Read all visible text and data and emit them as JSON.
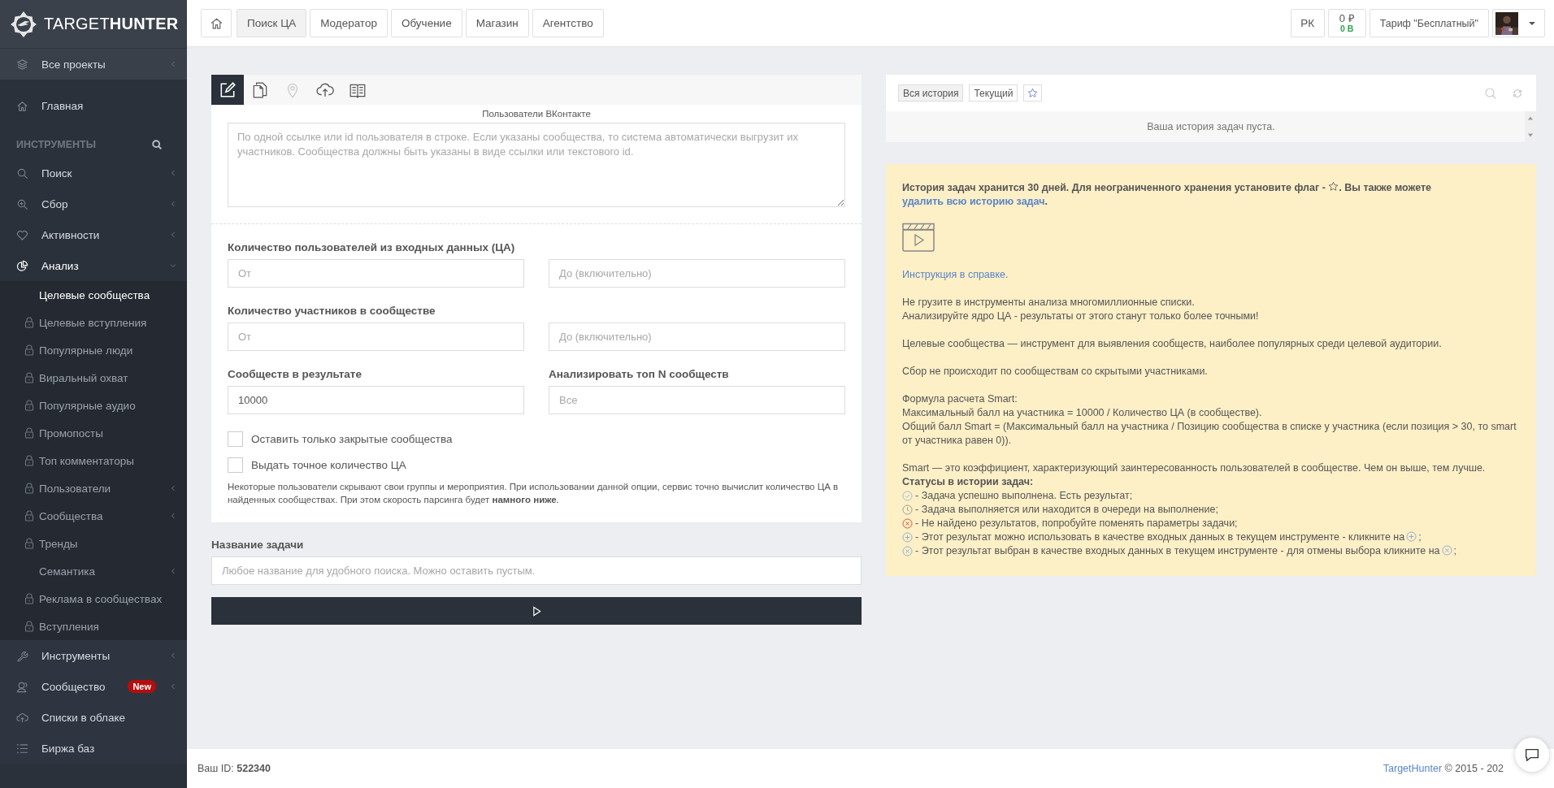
{
  "sidebar": {
    "logo": {
      "light": "TARGET",
      "bold": "HUNTER"
    },
    "items": [
      {
        "kind": "band",
        "label": "Все проекты",
        "has_submenu": true
      },
      {
        "kind": "link",
        "label": "Главная"
      },
      {
        "kind": "header",
        "label": "ИНСТРУМЕНТЫ"
      },
      {
        "kind": "link",
        "label": "Поиск",
        "has_submenu": true
      },
      {
        "kind": "link",
        "label": "Сбор",
        "has_submenu": true
      },
      {
        "kind": "link",
        "label": "Активности",
        "has_submenu": true
      },
      {
        "kind": "link",
        "label": "Анализ",
        "has_submenu": true,
        "expanded": true,
        "children": [
          {
            "label": "Целевые сообщества",
            "locked": false,
            "selected": true
          },
          {
            "label": "Целевые вступления",
            "locked": true,
            "selected": false
          },
          {
            "label": "Популярные люди",
            "locked": true,
            "selected": false
          },
          {
            "label": "Виральный охват",
            "locked": true,
            "selected": false
          },
          {
            "label": "Популярные аудио",
            "locked": true,
            "selected": false
          },
          {
            "label": "Промопосты",
            "locked": true,
            "selected": false
          },
          {
            "label": "Топ комментаторы",
            "locked": true,
            "selected": false
          },
          {
            "label": "Пользователи",
            "locked": true,
            "selected": false,
            "has_submenu": true
          },
          {
            "label": "Сообщества",
            "locked": true,
            "selected": false,
            "has_submenu": true
          },
          {
            "label": "Тренды",
            "locked": true,
            "selected": false
          },
          {
            "label": "Семантика",
            "locked": false,
            "selected": false,
            "has_submenu": true
          },
          {
            "label": "Реклама в сообществах",
            "locked": true,
            "selected": false
          },
          {
            "label": "Вступления",
            "locked": true,
            "selected": false
          }
        ]
      },
      {
        "kind": "lower",
        "label": "Инструменты",
        "has_submenu": true
      },
      {
        "kind": "lower",
        "label": "Сообщество",
        "badge": "New",
        "has_submenu": true
      },
      {
        "kind": "lower",
        "label": "Списки в облаке"
      },
      {
        "kind": "lower",
        "label": "Биржа баз"
      }
    ]
  },
  "topbar": {
    "tabs": [
      {
        "label": "Поиск ЦА",
        "selected": true
      },
      {
        "label": "Модератор",
        "selected": false
      },
      {
        "label": "Обучение",
        "selected": false
      },
      {
        "label": "Магазин",
        "selected": false
      },
      {
        "label": "Агентство",
        "selected": false
      }
    ],
    "rk": "РК",
    "balance": "0 ₽",
    "bonus": "0 В",
    "tariff": "Тариф \"Бесплатный\""
  },
  "form": {
    "tabs": [
      {
        "selected": true,
        "disabled": false
      },
      {
        "selected": false,
        "disabled": false
      },
      {
        "selected": false,
        "disabled": true
      },
      {
        "selected": false,
        "disabled": false
      },
      {
        "selected": false,
        "disabled": false
      }
    ],
    "source_label": "Пользователи ВКонтакте",
    "source_placeholder": "По одной ссылке или id пользователя в строке. Если указаны сообщества, то система автоматически выгрузит их участников. Сообщества должны быть указаны в виде ссылки или текстового id.",
    "rows": [
      [
        {
          "label": "Количество пользователей из входных данных (ЦА)",
          "placeholder": "От"
        },
        {
          "placeholder": "До (включительно)"
        }
      ],
      [
        {
          "label": "Количество участников в сообществе",
          "placeholder": "От"
        },
        {
          "placeholder": "До (включительно)"
        }
      ],
      [
        {
          "label": "Сообществ в результате",
          "value": "10000"
        },
        {
          "label": "Анализировать топ N сообществ",
          "placeholder": "Все"
        }
      ]
    ],
    "checkboxes": [
      {
        "label": "Оставить только закрытые сообщества",
        "checked": false
      },
      {
        "label": "Выдать точное количество ЦА",
        "checked": false
      }
    ],
    "note": "Некоторые пользователи скрывают свои группы и мероприятия. При использовании данной опции, сервис точно вычислит количество ЦА в найденных сообществах. При этом скорость парсинга будет **намного ниже**.",
    "task_label": "Название задачи",
    "task_placeholder": "Любое название для удобного поиска. Можно оставить пустым."
  },
  "history": {
    "filters": [
      {
        "label": "Вся история",
        "selected": true
      },
      {
        "label": "Текущий",
        "selected": false
      }
    ],
    "empty": "Ваша история задач пуста."
  },
  "notice": {
    "intro_before": "История задач хранится 30 дней. Для неограниченного хранения установите флаг - ",
    "intro_after": ". Вы также можете ",
    "delete_link": "удалить всю историю задач",
    "intro_end": ".",
    "help_link": "Инструкция в справке.",
    "paragraphs": [
      [
        "Не грузите в инструменты анализа многомиллионные списки.",
        "Анализируйте ядро ЦА - результаты от этого станут только более точными!"
      ],
      [
        "Целевые сообщества — инструмент для выявления сообществ, наиболее популярных среди целевой аудитории."
      ],
      [
        "Сбор не происходит по сообществам со скрытыми участниками."
      ],
      [
        "Формула расчета Smart:",
        "Максимальный балл на участника = 10000 / Количество ЦА (в сообществе).",
        "Общий балл Smart = (Максимальный балл на участника / Позицию сообщества в списке у участника (если позиция > 30, то smart от участника равен 0))."
      ],
      [
        "Smart — это коэффициент, характеризующий заинтересованность пользователей в сообществе. Чем он выше, тем лучше."
      ]
    ],
    "statuses_title": "Статусы в истории задач:",
    "statuses": [
      {
        "kind": "done",
        "text": "- Задача успешно выполнена. Есть результат;"
      },
      {
        "kind": "pending",
        "text": "- Задача выполняется или находится в очереди на выполнение;"
      },
      {
        "kind": "failed",
        "text": "- Не найдено результатов, попробуйте поменять параметры задачи;"
      },
      {
        "kind": "add",
        "text": "- Этот результат можно использовать в качестве входных данных в текущем инструменте - кликните на",
        "end": ";"
      },
      {
        "kind": "chosen",
        "text": "- Этот результат выбран в качестве входных данных в текущем инструменте - для отмены выбора кликните на",
        "end": ";"
      }
    ]
  },
  "footer": {
    "id_label": "Ваш ID:",
    "id": "522340",
    "brand": "TargetHunter",
    "copyright": "© 2015 - 202"
  }
}
